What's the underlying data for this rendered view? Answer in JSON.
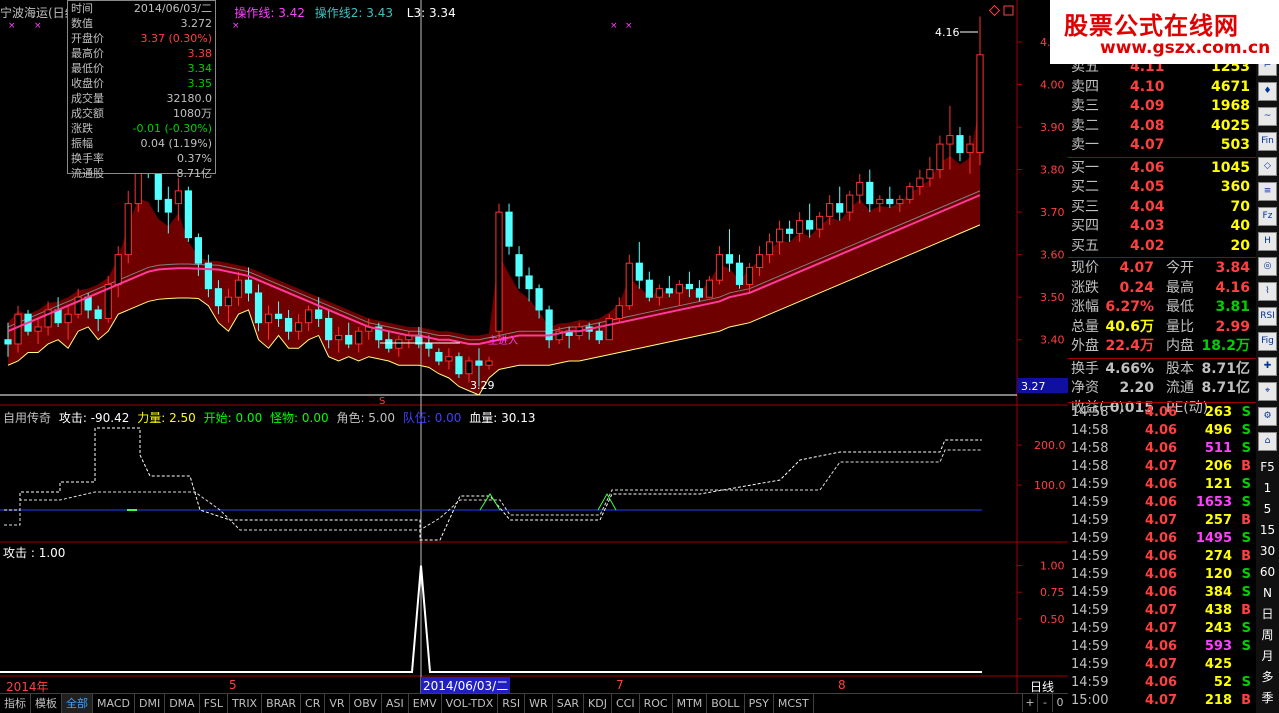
{
  "topbar": {
    "stock_name": "宁波海运(日线",
    "op_line1_label": "操作线: ",
    "op_line1_value": "3.42",
    "op_line2_label": "操作线2: ",
    "op_line2_value": "3.43",
    "l3_label": "L3: ",
    "l3_value": "3.34"
  },
  "info_box": {
    "rows": [
      {
        "label": "时间",
        "value": "2014/06/03/二",
        "color": "#c0c0c0"
      },
      {
        "label": "数值",
        "value": "3.272",
        "color": "#c0c0c0"
      },
      {
        "label": "开盘价",
        "value": "3.37 (0.30%)",
        "color": "#ff4040"
      },
      {
        "label": "最高价",
        "value": "3.38",
        "color": "#ff4040"
      },
      {
        "label": "最低价",
        "value": "3.34",
        "color": "#00d000"
      },
      {
        "label": "收盘价",
        "value": "3.35",
        "color": "#00d000"
      },
      {
        "label": "成交量",
        "value": "32180.0",
        "color": "#c0c0c0"
      },
      {
        "label": "成交额",
        "value": "1080万",
        "color": "#c0c0c0"
      },
      {
        "label": "涨跌",
        "value": "-0.01 (-0.30%)",
        "color": "#00d000"
      },
      {
        "label": "振幅",
        "value": "0.04 (1.19%)",
        "color": "#c0c0c0"
      },
      {
        "label": "换手率",
        "value": "0.37%",
        "color": "#c0c0c0"
      },
      {
        "label": "流通股",
        "value": "8.71亿",
        "color": "#c0c0c0"
      }
    ]
  },
  "price_axis": [
    "4.10",
    "4.00",
    "3.90",
    "3.80",
    "3.70",
    "3.60",
    "3.50",
    "3.40"
  ],
  "price_marker": {
    "label": "3.27"
  },
  "price_annotations": {
    "high_label": "4.16",
    "low_label": "3.29",
    "mid_label": "主进入",
    "s_marker": "S"
  },
  "indicator1": {
    "name": "自用传奇",
    "attack_label": "攻击: ",
    "attack_value": "-90.42",
    "power_label": "力量: ",
    "power_value": "2.50",
    "start_label": "开始: ",
    "start_value": "0.00",
    "monster_label": "怪物: ",
    "monster_value": "0.00",
    "role_label": "角色: ",
    "role_value": "5.00",
    "team_label": "队伍: ",
    "team_value": "0.00",
    "blood_label": "血量: ",
    "blood_value": "30.13",
    "axis": [
      "200.0",
      "100.0"
    ]
  },
  "indicator2": {
    "attack_label": "攻击 : ",
    "attack_value": "1.00",
    "axis": [
      "1.00",
      "0.75",
      "0.50"
    ]
  },
  "date_axis": {
    "year": "2014年",
    "m5": "5",
    "m7": "7",
    "m8": "8",
    "cursor_date": "2014/06/03/二",
    "period": "日线"
  },
  "order_book": {
    "sells": [
      {
        "label": "卖五",
        "price": "4.11",
        "vol": "1253"
      },
      {
        "label": "卖四",
        "price": "4.10",
        "vol": "4671"
      },
      {
        "label": "卖三",
        "price": "4.09",
        "vol": "1968"
      },
      {
        "label": "卖二",
        "price": "4.08",
        "vol": "4025"
      },
      {
        "label": "卖一",
        "price": "4.07",
        "vol": "503"
      }
    ],
    "buys": [
      {
        "label": "买一",
        "price": "4.06",
        "vol": "1045"
      },
      {
        "label": "买二",
        "price": "4.05",
        "vol": "360"
      },
      {
        "label": "买三",
        "price": "4.04",
        "vol": "70"
      },
      {
        "label": "买四",
        "price": "4.03",
        "vol": "40"
      },
      {
        "label": "买五",
        "price": "4.02",
        "vol": "20"
      }
    ]
  },
  "quote": {
    "rows": [
      {
        "l1": "现价",
        "v1": "4.07",
        "c1": "#ff4040",
        "l2": "今开",
        "v2": "3.84",
        "c2": "#ff4040"
      },
      {
        "l1": "涨跌",
        "v1": "0.24",
        "c1": "#ff4040",
        "l2": "最高",
        "v2": "4.16",
        "c2": "#ff4040"
      },
      {
        "l1": "涨幅",
        "v1": "6.27%",
        "c1": "#ff4040",
        "l2": "最低",
        "v2": "3.81",
        "c2": "#00d000"
      },
      {
        "l1": "总量",
        "v1": "40.6万",
        "c1": "#ffff00",
        "l2": "量比",
        "v2": "2.99",
        "c2": "#ff4040"
      },
      {
        "l1": "外盘",
        "v1": "22.4万",
        "c1": "#ff4040",
        "l2": "内盘",
        "v2": "18.2万",
        "c2": "#00d000"
      },
      {
        "l1": "换手",
        "v1": "4.66%",
        "c1": "#c0c0c0",
        "l2": "股本",
        "v2": "8.71亿",
        "c2": "#c0c0c0"
      },
      {
        "l1": "净资",
        "v1": "2.20",
        "c1": "#c0c0c0",
        "l2": "流通",
        "v2": "8.71亿",
        "c2": "#c0c0c0"
      },
      {
        "l1": "收益(一)",
        "v1": "0.015",
        "c1": "#c0c0c0",
        "l2": "PE(动)",
        "v2": "",
        "c2": "#c0c0c0"
      }
    ]
  },
  "ticks": [
    {
      "time": "14:58",
      "price": "4.06",
      "vol": "263",
      "side": "S"
    },
    {
      "time": "14:58",
      "price": "4.06",
      "vol": "496",
      "side": "S"
    },
    {
      "time": "14:58",
      "price": "4.06",
      "vol": "511",
      "side": "S"
    },
    {
      "time": "14:58",
      "price": "4.07",
      "vol": "206",
      "side": "B"
    },
    {
      "time": "14:59",
      "price": "4.06",
      "vol": "121",
      "side": "S"
    },
    {
      "time": "14:59",
      "price": "4.06",
      "vol": "1653",
      "side": "S"
    },
    {
      "time": "14:59",
      "price": "4.07",
      "vol": "257",
      "side": "B"
    },
    {
      "time": "14:59",
      "price": "4.06",
      "vol": "1495",
      "side": "S"
    },
    {
      "time": "14:59",
      "price": "4.06",
      "vol": "274",
      "side": "B"
    },
    {
      "time": "14:59",
      "price": "4.06",
      "vol": "120",
      "side": "S"
    },
    {
      "time": "14:59",
      "price": "4.06",
      "vol": "384",
      "side": "S"
    },
    {
      "time": "14:59",
      "price": "4.07",
      "vol": "438",
      "side": "B"
    },
    {
      "time": "14:59",
      "price": "4.07",
      "vol": "243",
      "side": "S"
    },
    {
      "time": "14:59",
      "price": "4.06",
      "vol": "593",
      "side": "S"
    },
    {
      "time": "14:59",
      "price": "4.07",
      "vol": "425",
      "side": ""
    },
    {
      "time": "14:59",
      "price": "4.06",
      "vol": "52",
      "side": "S"
    },
    {
      "time": "15:00",
      "price": "4.07",
      "vol": "218",
      "side": "B"
    }
  ],
  "watermark": {
    "title": "股票公式在线网",
    "url": "www.gszx.com.cn"
  },
  "sidebar": {
    "buttons": [
      "iii",
      "⌐",
      "♦",
      "~",
      "Fin",
      "◇",
      "≡",
      "Fz",
      "H",
      "◎",
      "⌇",
      "RSI",
      "Fig",
      "✚",
      "⌖",
      "⚙",
      "⌂"
    ],
    "labels": [
      "F5",
      "1",
      "5",
      "15",
      "30",
      "60",
      "N",
      "日",
      "周",
      "月",
      "多",
      "季"
    ]
  },
  "bottom_tabs": [
    "指标",
    "模板",
    "全部",
    "MACD",
    "DMI",
    "DMA",
    "FSL",
    "TRIX",
    "BRAR",
    "CR",
    "VR",
    "OBV",
    "ASI",
    "EMV",
    "VOL-TDX",
    "RSI",
    "WR",
    "SAR",
    "KDJ",
    "CCI",
    "ROC",
    "MTM",
    "BOLL",
    "PSY",
    "MCST"
  ],
  "scroll_buttons": [
    "+",
    "-",
    "0"
  ],
  "chart_data": {
    "type": "candlestick",
    "title": "宁波海运(日线)",
    "ylim": [
      3.27,
      4.18
    ],
    "candles": [
      [
        3.4,
        3.44,
        3.36,
        3.39
      ],
      [
        3.39,
        3.48,
        3.37,
        3.46
      ],
      [
        3.46,
        3.47,
        3.41,
        3.42
      ],
      [
        3.42,
        3.45,
        3.39,
        3.43
      ],
      [
        3.43,
        3.49,
        3.41,
        3.47
      ],
      [
        3.47,
        3.5,
        3.43,
        3.44
      ],
      [
        3.44,
        3.48,
        3.4,
        3.46
      ],
      [
        3.46,
        3.52,
        3.45,
        3.5
      ],
      [
        3.5,
        3.51,
        3.45,
        3.47
      ],
      [
        3.47,
        3.48,
        3.42,
        3.45
      ],
      [
        3.45,
        3.55,
        3.44,
        3.53
      ],
      [
        3.53,
        3.62,
        3.5,
        3.6
      ],
      [
        3.6,
        3.75,
        3.58,
        3.72
      ],
      [
        3.72,
        3.88,
        3.7,
        3.82
      ],
      [
        3.82,
        3.92,
        3.78,
        3.8
      ],
      [
        3.8,
        3.82,
        3.7,
        3.73
      ],
      [
        3.73,
        3.76,
        3.65,
        3.7
      ],
      [
        3.72,
        3.78,
        3.68,
        3.75
      ],
      [
        3.75,
        3.76,
        3.63,
        3.64
      ],
      [
        3.64,
        3.65,
        3.55,
        3.58
      ],
      [
        3.58,
        3.6,
        3.5,
        3.52
      ],
      [
        3.52,
        3.54,
        3.46,
        3.48
      ],
      [
        3.48,
        3.52,
        3.44,
        3.5
      ],
      [
        3.5,
        3.56,
        3.48,
        3.54
      ],
      [
        3.54,
        3.57,
        3.49,
        3.51
      ],
      [
        3.51,
        3.53,
        3.42,
        3.44
      ],
      [
        3.44,
        3.48,
        3.4,
        3.46
      ],
      [
        3.46,
        3.49,
        3.43,
        3.45
      ],
      [
        3.45,
        3.47,
        3.4,
        3.42
      ],
      [
        3.42,
        3.46,
        3.4,
        3.44
      ],
      [
        3.44,
        3.48,
        3.42,
        3.47
      ],
      [
        3.47,
        3.5,
        3.43,
        3.45
      ],
      [
        3.45,
        3.47,
        3.38,
        3.4
      ],
      [
        3.4,
        3.43,
        3.37,
        3.41
      ],
      [
        3.41,
        3.44,
        3.38,
        3.39
      ],
      [
        3.39,
        3.43,
        3.37,
        3.42
      ],
      [
        3.42,
        3.45,
        3.4,
        3.43
      ],
      [
        3.43,
        3.44,
        3.38,
        3.4
      ],
      [
        3.4,
        3.42,
        3.37,
        3.38
      ],
      [
        3.38,
        3.41,
        3.36,
        3.4
      ],
      [
        3.4,
        3.42,
        3.38,
        3.41
      ],
      [
        3.41,
        3.43,
        3.38,
        3.39
      ],
      [
        3.39,
        3.41,
        3.36,
        3.38
      ],
      [
        3.37,
        3.38,
        3.34,
        3.35
      ],
      [
        3.35,
        3.38,
        3.33,
        3.36
      ],
      [
        3.36,
        3.37,
        3.31,
        3.32
      ],
      [
        3.32,
        3.36,
        3.3,
        3.35
      ],
      [
        3.35,
        3.38,
        3.29,
        3.34
      ],
      [
        3.34,
        3.36,
        3.33,
        3.35
      ],
      [
        3.42,
        3.72,
        3.4,
        3.7
      ],
      [
        3.7,
        3.72,
        3.6,
        3.62
      ],
      [
        3.6,
        3.62,
        3.52,
        3.55
      ],
      [
        3.55,
        3.57,
        3.49,
        3.52
      ],
      [
        3.52,
        3.53,
        3.45,
        3.47
      ],
      [
        3.47,
        3.48,
        3.38,
        3.4
      ],
      [
        3.4,
        3.43,
        3.39,
        3.42
      ],
      [
        3.42,
        3.43,
        3.38,
        3.41
      ],
      [
        3.41,
        3.44,
        3.4,
        3.43
      ],
      [
        3.43,
        3.44,
        3.4,
        3.42
      ],
      [
        3.42,
        3.44,
        3.39,
        3.4
      ],
      [
        3.4,
        3.46,
        3.4,
        3.45
      ],
      [
        3.45,
        3.5,
        3.44,
        3.48
      ],
      [
        3.48,
        3.6,
        3.47,
        3.58
      ],
      [
        3.58,
        3.63,
        3.52,
        3.54
      ],
      [
        3.54,
        3.56,
        3.49,
        3.5
      ],
      [
        3.5,
        3.53,
        3.48,
        3.52
      ],
      [
        3.52,
        3.55,
        3.5,
        3.51
      ],
      [
        3.51,
        3.54,
        3.48,
        3.53
      ],
      [
        3.53,
        3.56,
        3.5,
        3.52
      ],
      [
        3.52,
        3.54,
        3.49,
        3.5
      ],
      [
        3.5,
        3.55,
        3.5,
        3.54
      ],
      [
        3.54,
        3.62,
        3.53,
        3.6
      ],
      [
        3.6,
        3.66,
        3.56,
        3.58
      ],
      [
        3.58,
        3.6,
        3.52,
        3.53
      ],
      [
        3.53,
        3.58,
        3.51,
        3.57
      ],
      [
        3.57,
        3.62,
        3.55,
        3.6
      ],
      [
        3.6,
        3.65,
        3.58,
        3.63
      ],
      [
        3.63,
        3.68,
        3.6,
        3.66
      ],
      [
        3.66,
        3.68,
        3.63,
        3.65
      ],
      [
        3.65,
        3.7,
        3.63,
        3.68
      ],
      [
        3.68,
        3.72,
        3.64,
        3.66
      ],
      [
        3.66,
        3.7,
        3.64,
        3.69
      ],
      [
        3.69,
        3.74,
        3.67,
        3.72
      ],
      [
        3.72,
        3.76,
        3.68,
        3.7
      ],
      [
        3.7,
        3.75,
        3.68,
        3.74
      ],
      [
        3.74,
        3.79,
        3.72,
        3.77
      ],
      [
        3.77,
        3.8,
        3.7,
        3.72
      ],
      [
        3.72,
        3.74,
        3.7,
        3.73
      ],
      [
        3.73,
        3.76,
        3.71,
        3.72
      ],
      [
        3.72,
        3.74,
        3.7,
        3.73
      ],
      [
        3.73,
        3.77,
        3.72,
        3.76
      ],
      [
        3.76,
        3.8,
        3.74,
        3.78
      ],
      [
        3.78,
        3.83,
        3.76,
        3.8
      ],
      [
        3.8,
        3.88,
        3.78,
        3.86
      ],
      [
        3.86,
        3.95,
        3.8,
        3.88
      ],
      [
        3.88,
        3.9,
        3.82,
        3.84
      ],
      [
        3.84,
        3.88,
        3.79,
        3.86
      ],
      [
        3.84,
        4.16,
        3.81,
        4.07
      ]
    ],
    "ma_pink": [
      3.42,
      3.43,
      3.44,
      3.45,
      3.46,
      3.47,
      3.48,
      3.49,
      3.5,
      3.51,
      3.52,
      3.53,
      3.54,
      3.55,
      3.56,
      3.565,
      3.567,
      3.568,
      3.568,
      3.567,
      3.566,
      3.565,
      3.56,
      3.555,
      3.55,
      3.54,
      3.53,
      3.52,
      3.51,
      3.5,
      3.49,
      3.48,
      3.47,
      3.46,
      3.45,
      3.44,
      3.43,
      3.425,
      3.42,
      3.415,
      3.41,
      3.41,
      3.405,
      3.4,
      3.4,
      3.395,
      3.39,
      3.39,
      3.395,
      3.4,
      3.405,
      3.41,
      3.41,
      3.41,
      3.41,
      3.415,
      3.42,
      3.42,
      3.425,
      3.43,
      3.435,
      3.44,
      3.445,
      3.45,
      3.455,
      3.46,
      3.465,
      3.47,
      3.475,
      3.48,
      3.485,
      3.49,
      3.5,
      3.505,
      3.51,
      3.52,
      3.53,
      3.54,
      3.55,
      3.56,
      3.57,
      3.58,
      3.59,
      3.6,
      3.61,
      3.62,
      3.63,
      3.64,
      3.65,
      3.66,
      3.67,
      3.68,
      3.69,
      3.7,
      3.71,
      3.72,
      3.73,
      3.74
    ],
    "ind1_axis_range": [
      0,
      300
    ],
    "ind2_axis_range": [
      0,
      1.1
    ]
  }
}
